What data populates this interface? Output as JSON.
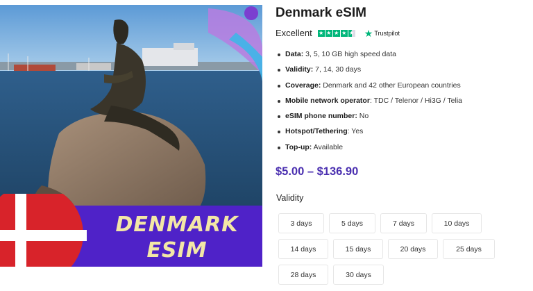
{
  "hero": {
    "banner_line1": "DENMARK",
    "banner_line2": "ESIM"
  },
  "product": {
    "title": "Denmark eSIM",
    "rating_label": "Excellent",
    "rating_stars": 4.5,
    "rating_source": "Trustpilot",
    "price_range": "$5.00 – $136.90"
  },
  "features": [
    {
      "label": "Data:",
      "value": " 3, 5, 10 GB high speed data"
    },
    {
      "label": "Validity:",
      "value": " 7, 14, 30 days"
    },
    {
      "label": "Coverage:",
      "value": " Denmark and 42 other European countries"
    },
    {
      "label": "Mobile network operator",
      "value": ": TDC / Telenor / Hi3G / Telia"
    },
    {
      "label": "eSIM phone number:",
      "value": " No"
    },
    {
      "label": "Hotspot/Tethering",
      "value": ": Yes"
    },
    {
      "label": "Top-up:",
      "value": " Available"
    }
  ],
  "validity": {
    "label": "Validity",
    "options": [
      "3 days",
      "5 days",
      "7 days",
      "10 days",
      "14 days",
      "15 days",
      "20 days",
      "25 days",
      "28 days",
      "30 days"
    ]
  },
  "colors": {
    "price": "#4a2fb0",
    "trustpilot_green": "#00b67a",
    "banner_purple": "#4f22c8",
    "flag_red": "#d8232a"
  }
}
